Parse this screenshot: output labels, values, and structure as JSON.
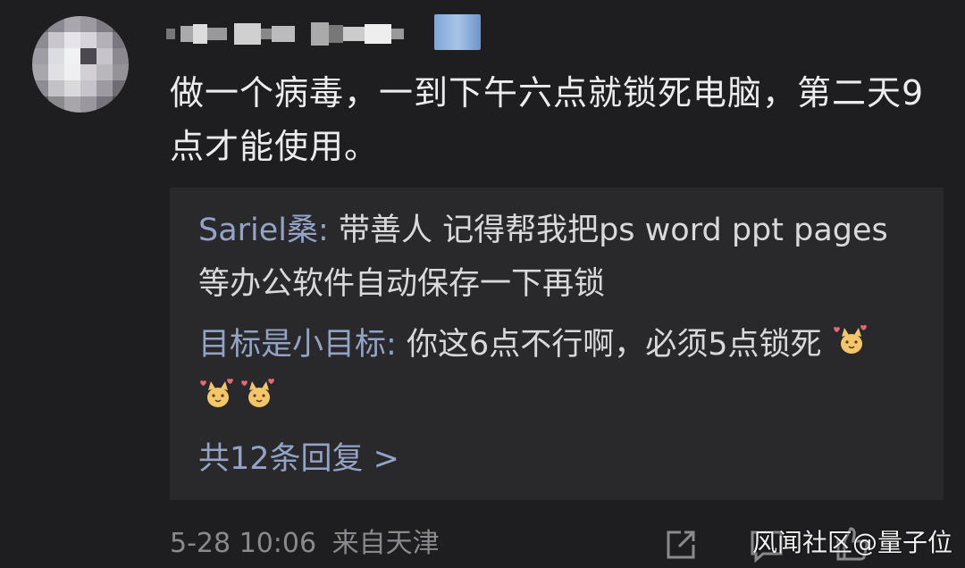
{
  "comment": {
    "text": "做一个病毒，一到下午六点就锁死电脑，第二天9点才能使用。"
  },
  "replies": [
    {
      "author": "Sariel桑",
      "separator": ": ",
      "text": "带善人 记得帮我把ps word ppt pages 等办公软件自动保存一下再锁"
    },
    {
      "author": "目标是小目标",
      "separator": ": ",
      "text": "你这6点不行啊，必须5点锁死"
    }
  ],
  "reply_emoji_icons": [
    "cat-heart-icon",
    "cat-heart-icon",
    "cat-heart-icon"
  ],
  "more_replies_label": "共12条回复 >",
  "meta": {
    "date_time": "5-28 10:06",
    "location": "来自天津"
  },
  "actions": [
    "share-icon",
    "comment-icon",
    "like-icon"
  ],
  "watermark": "风闻社区@量子位",
  "colors": {
    "background": "#1e1e20",
    "reply_box": "#29292b",
    "author_link": "#93a3c6",
    "meta_text": "#8a8a8e"
  }
}
